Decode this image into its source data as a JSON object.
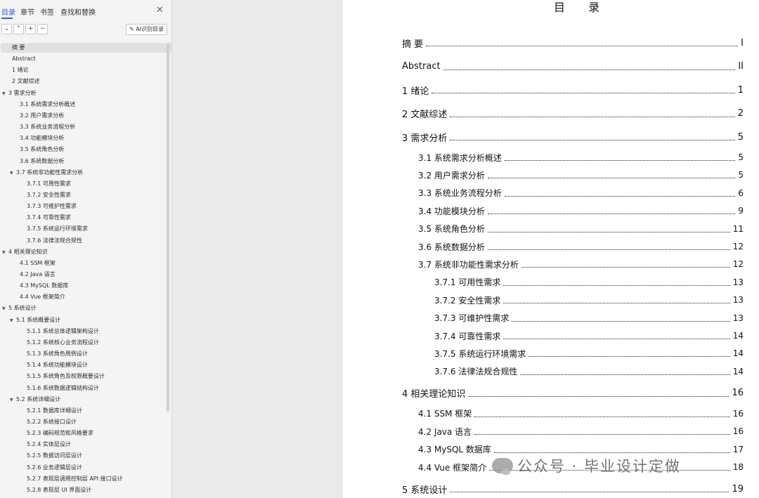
{
  "sidebar": {
    "tabs": [
      "目录",
      "章节",
      "书签",
      "查找和替换"
    ],
    "close_icon": "close-icon",
    "toolbar": {
      "collapse_all": "⌄",
      "expand_up": "⌃",
      "add": "+",
      "remove": "−",
      "ai_label": "AI识别目录",
      "ai_icon": "magic-wand-icon"
    },
    "toc": [
      {
        "label": "摘  要",
        "level": 0,
        "caret": false,
        "selected": true
      },
      {
        "label": "Abstract",
        "level": 0,
        "caret": false
      },
      {
        "label": "1  绪论",
        "level": 0,
        "caret": false
      },
      {
        "label": "2  文献综述",
        "level": 0,
        "caret": false
      },
      {
        "label": "3  需求分析",
        "level": 0,
        "caret": true
      },
      {
        "label": "3.1  系统需求分析概述",
        "level": 1,
        "caret": false
      },
      {
        "label": "3.2  用户需求分析",
        "level": 1,
        "caret": false
      },
      {
        "label": "3.3  系统业务流程分析",
        "level": 1,
        "caret": false
      },
      {
        "label": "3.4  功能模块分析",
        "level": 1,
        "caret": false
      },
      {
        "label": "3.5  系统角色分析",
        "level": 1,
        "caret": false
      },
      {
        "label": "3.6  系统数据分析",
        "level": 1,
        "caret": false
      },
      {
        "label": "3.7  系统非功能性需求分析",
        "level": 1,
        "caret": true
      },
      {
        "label": "3.7.1 可用性需求",
        "level": 2,
        "caret": false
      },
      {
        "label": "3.7.2 安全性需求",
        "level": 2,
        "caret": false
      },
      {
        "label": "3.7.3 可维护性需求",
        "level": 2,
        "caret": false
      },
      {
        "label": "3.7.4 可靠性需求",
        "level": 2,
        "caret": false
      },
      {
        "label": "3.7.5 系统运行环境需求",
        "level": 2,
        "caret": false
      },
      {
        "label": "3.7.6 法律法规合规性",
        "level": 2,
        "caret": false
      },
      {
        "label": "4  相关理论知识",
        "level": 0,
        "caret": true
      },
      {
        "label": "4.1 SSM 框架",
        "level": 1,
        "caret": false
      },
      {
        "label": "4.2 Java 语言",
        "level": 1,
        "caret": false
      },
      {
        "label": "4.3 MySQL 数据库",
        "level": 1,
        "caret": false
      },
      {
        "label": "4.4 Vue 框架简介",
        "level": 1,
        "caret": false
      },
      {
        "label": "5  系统设计",
        "level": 0,
        "caret": true
      },
      {
        "label": "5.1 系统概要设计",
        "level": 1,
        "caret": true
      },
      {
        "label": "5.1.1 系统总体逻辑架构设计",
        "level": 2,
        "caret": false
      },
      {
        "label": "5.1.2 系统核心业务流程设计",
        "level": 2,
        "caret": false
      },
      {
        "label": "5.1.3 系统角色用例设计",
        "level": 2,
        "caret": false
      },
      {
        "label": "5.1.4 系统功能模块设计",
        "level": 2,
        "caret": false
      },
      {
        "label": "5.1.5 系统角色及权限概要设计",
        "level": 2,
        "caret": false
      },
      {
        "label": "5.1.6 系统数据逻辑结构设计",
        "level": 2,
        "caret": false
      },
      {
        "label": "5.2 系统详细设计",
        "level": 1,
        "caret": true
      },
      {
        "label": "5.2.1 数据库详细设计",
        "level": 2,
        "caret": false
      },
      {
        "label": "5.2.2 系统接口设计",
        "level": 2,
        "caret": false
      },
      {
        "label": "5.2.3 编码规范和风格要求",
        "level": 2,
        "caret": false
      },
      {
        "label": "5.2.4 实体层设计",
        "level": 2,
        "caret": false
      },
      {
        "label": "5.2.5 数据访问层设计",
        "level": 2,
        "caret": false
      },
      {
        "label": "5.2.6 业务逻辑层设计",
        "level": 2,
        "caret": false
      },
      {
        "label": "5.2.7 表现层调用控制层 API 接口设计",
        "level": 2,
        "caret": false
      },
      {
        "label": "5.2.8 表现层 UI 界面设计",
        "level": 2,
        "caret": false
      }
    ]
  },
  "page": {
    "title": "目  录",
    "entries": [
      {
        "title": "摘  要",
        "page": "I",
        "level": 1
      },
      {
        "title": "Abstract",
        "page": "II",
        "level": 1
      },
      {
        "title": "1  绪论",
        "page": "1",
        "level": 1
      },
      {
        "title": "2  文献综述",
        "page": "2",
        "level": 1
      },
      {
        "title": "3  需求分析",
        "page": "5",
        "level": 1
      },
      {
        "title": "3.1  系统需求分析概述",
        "page": "5",
        "level": 2
      },
      {
        "title": "3.2  用户需求分析",
        "page": "5",
        "level": 2
      },
      {
        "title": "3.3  系统业务流程分析",
        "page": "6",
        "level": 2
      },
      {
        "title": "3.4  功能模块分析",
        "page": "9",
        "level": 2
      },
      {
        "title": "3.5  系统角色分析",
        "page": "11",
        "level": 2
      },
      {
        "title": "3.6  系统数据分析",
        "page": "12",
        "level": 2
      },
      {
        "title": "3.7  系统非功能性需求分析",
        "page": "12",
        "level": 2
      },
      {
        "title": "3.7.1 可用性需求",
        "page": "13",
        "level": 3
      },
      {
        "title": "3.7.2 安全性需求",
        "page": "13",
        "level": 3
      },
      {
        "title": "3.7.3 可维护性需求",
        "page": "13",
        "level": 3
      },
      {
        "title": "3.7.4 可靠性需求",
        "page": "14",
        "level": 3
      },
      {
        "title": "3.7.5 系统运行环境需求",
        "page": "14",
        "level": 3
      },
      {
        "title": "3.7.6 法律法规合规性",
        "page": "14",
        "level": 3
      },
      {
        "title": "4  相关理论知识",
        "page": "16",
        "level": 1
      },
      {
        "title": "4.1  SSM 框架",
        "page": "16",
        "level": 2
      },
      {
        "title": "4.2  Java 语言",
        "page": "16",
        "level": 2
      },
      {
        "title": "4.3  MySQL 数据库",
        "page": "17",
        "level": 2
      },
      {
        "title": "4.4  Vue 框架简介",
        "page": "18",
        "level": 2
      },
      {
        "title": "5  系统设计",
        "page": "19",
        "level": 1
      }
    ],
    "watermark": "公众号 · 毕业设计定做"
  }
}
